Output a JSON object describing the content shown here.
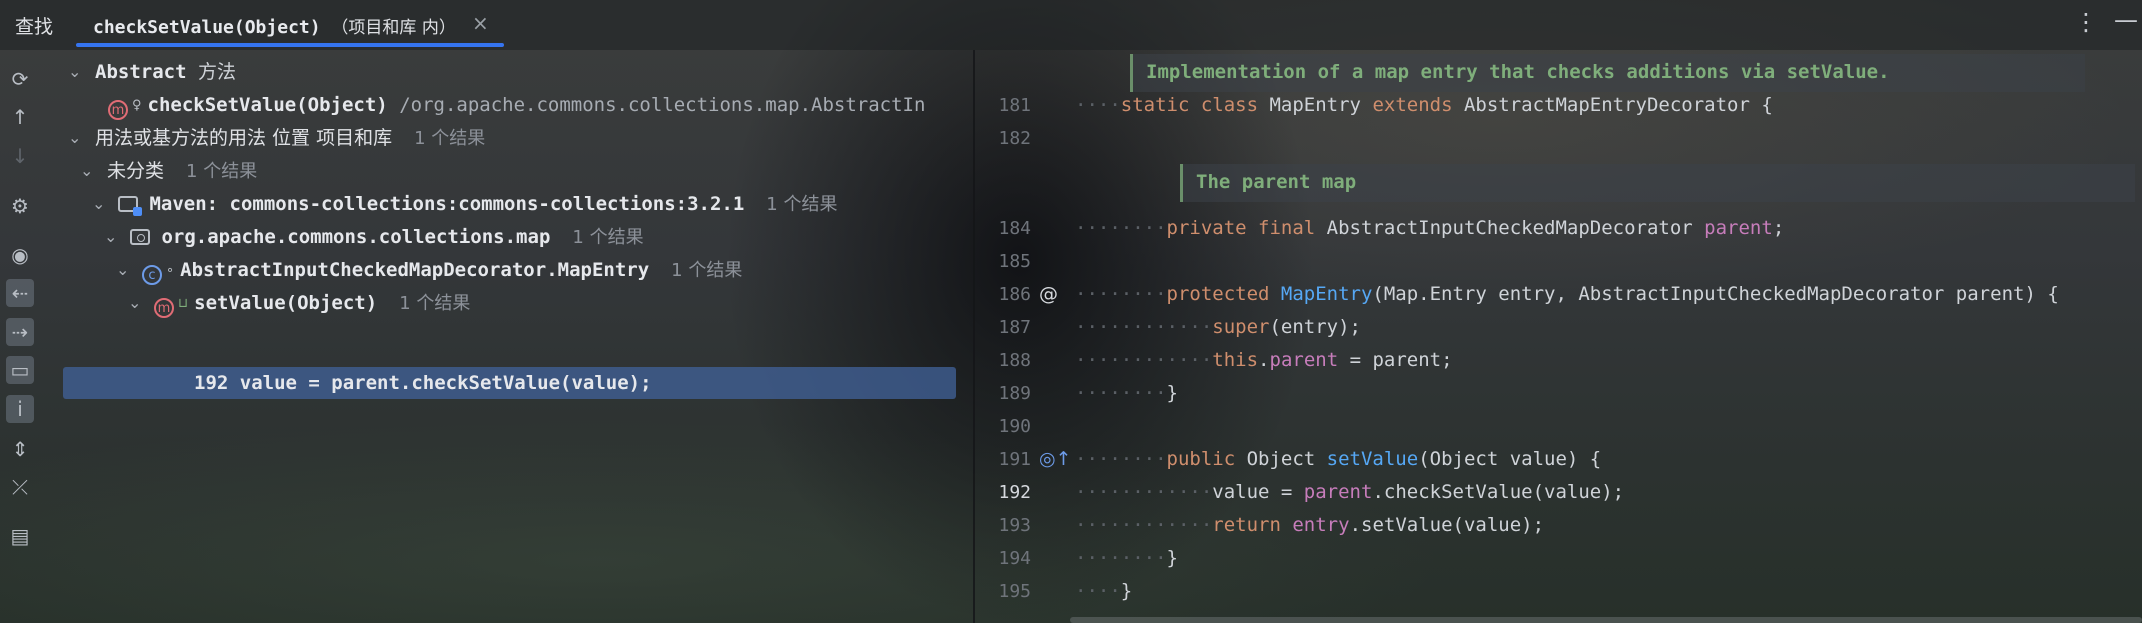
{
  "topbar": {
    "find_label": "查找",
    "tab_title": "checkSetValue(Object)",
    "tab_scope": "（项目和库 内）",
    "close_glyph": "×",
    "more_glyph": "⋮",
    "minimize_glyph": "—"
  },
  "toolbar": {
    "icons": [
      "refresh-icon",
      "arrow-up-icon",
      "arrow-down-icon",
      "settings-icon",
      "eye-icon",
      "read-access-icon",
      "write-access-icon",
      "folder-group-icon",
      "info-icon",
      "expand-all-icon",
      "collapse-all-icon",
      "preview-icon"
    ]
  },
  "tree": {
    "abstract_label": "Abstract",
    "abstract_suffix": "方法",
    "method_name": "checkSetValue(Object)",
    "method_path": "/org.apache.commons.collections.map.AbstractIn",
    "usages_label": "用法或基方法的用法 位置 项目和库",
    "usages_count": "1 个结果",
    "uncategorized_label": "未分类",
    "uncategorized_count": "1 个结果",
    "maven_label": "Maven: commons-collections:commons-collections:3.2.1",
    "maven_count": "1 个结果",
    "package_label": "org.apache.commons.collections.map",
    "package_count": "1 个结果",
    "class_label": "AbstractInputCheckedMapDecorator.MapEntry",
    "class_count": "1 个结果",
    "setvalue_label": "setValue(Object)",
    "setvalue_count": "1 个结果",
    "usage_line": "192 value = parent.checkSetValue(value);"
  },
  "editor": {
    "doc1": "Implementation of a map entry that checks additions via setValue.",
    "doc2": "The parent map",
    "lines": [
      {
        "num": "181",
        "dots": "····",
        "parts": [
          [
            "kw",
            "static class "
          ],
          [
            "",
            "MapEntry "
          ],
          [
            "kw",
            "extends "
          ],
          [
            "",
            "AbstractMapEntryDecorator {"
          ]
        ]
      },
      {
        "num": "182",
        "dots": "",
        "parts": []
      },
      {
        "num": "184",
        "dots": "········",
        "parts": [
          [
            "kw",
            "private final "
          ],
          [
            "",
            "AbstractInputCheckedMapDecorator "
          ],
          [
            "fld",
            "parent"
          ],
          [
            "",
            ";"
          ]
        ]
      },
      {
        "num": "185",
        "dots": "",
        "parts": []
      },
      {
        "num": "186",
        "dots": "········",
        "gutter": "@",
        "parts": [
          [
            "kw",
            "protected "
          ],
          [
            "fn",
            "MapEntry"
          ],
          [
            "",
            "(Map.Entry entry, AbstractInputCheckedMapDecorator parent) {"
          ]
        ]
      },
      {
        "num": "187",
        "dots": "············",
        "parts": [
          [
            "kw",
            "super"
          ],
          [
            "",
            "(entry);"
          ]
        ]
      },
      {
        "num": "188",
        "dots": "············",
        "parts": [
          [
            "kw",
            "this"
          ],
          [
            "",
            "."
          ],
          [
            "fld",
            "parent"
          ],
          [
            "",
            " = parent;"
          ]
        ]
      },
      {
        "num": "189",
        "dots": "········",
        "parts": [
          [
            "",
            "}"
          ]
        ]
      },
      {
        "num": "190",
        "dots": "",
        "parts": []
      },
      {
        "num": "191",
        "dots": "········",
        "gutter": "◎↑",
        "parts": [
          [
            "kw",
            "public "
          ],
          [
            "",
            "Object "
          ],
          [
            "fn",
            "setValue"
          ],
          [
            "",
            "(Object value) {"
          ]
        ]
      },
      {
        "num": "192",
        "dots": "············",
        "current": true,
        "parts": [
          [
            "",
            "value = "
          ],
          [
            "fld",
            "parent"
          ],
          [
            "",
            ".checkSetValue(value);"
          ]
        ]
      },
      {
        "num": "193",
        "dots": "············",
        "parts": [
          [
            "kw",
            "return "
          ],
          [
            "fld",
            "entry"
          ],
          [
            "",
            ".setValue(value);"
          ]
        ]
      },
      {
        "num": "194",
        "dots": "········",
        "parts": [
          [
            "",
            "}"
          ]
        ]
      },
      {
        "num": "195",
        "dots": "····",
        "parts": [
          [
            "",
            "}"
          ]
        ]
      }
    ]
  }
}
